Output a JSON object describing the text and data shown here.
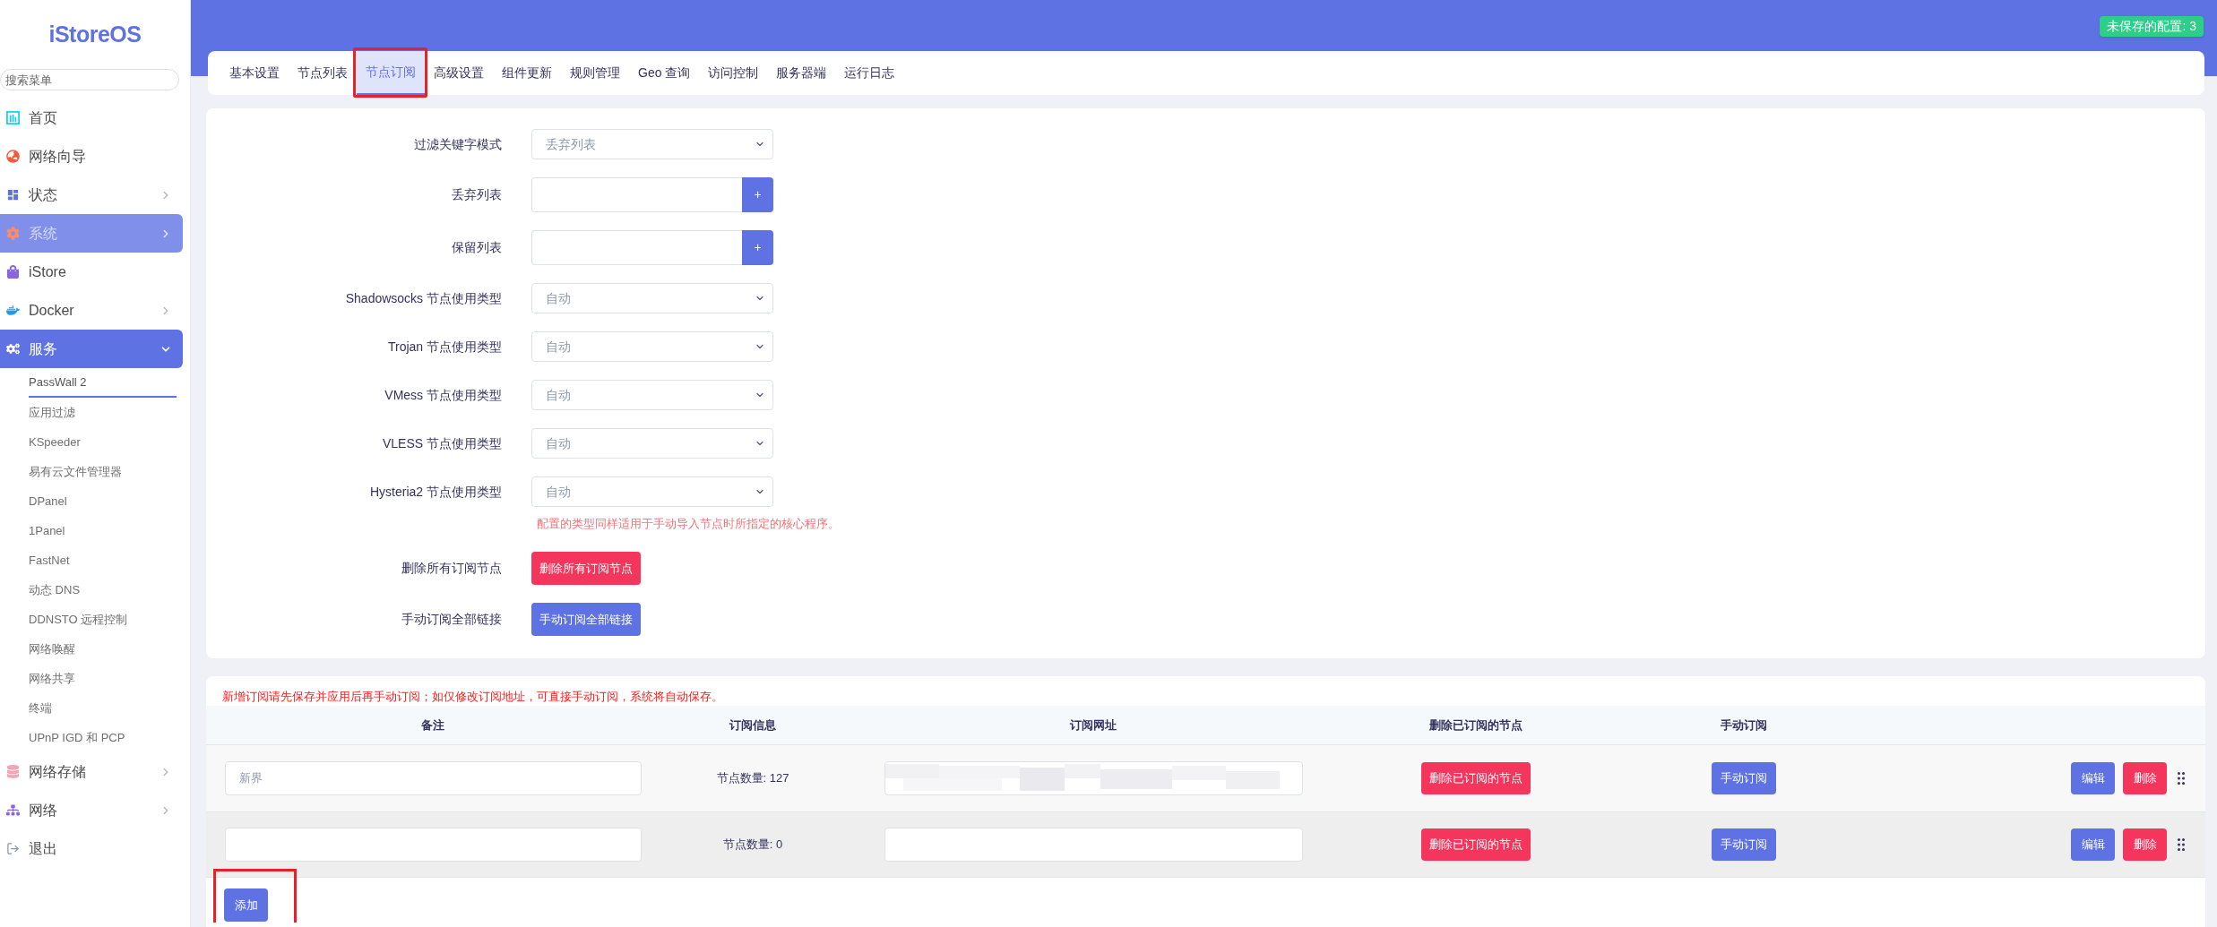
{
  "sidebar": {
    "logo": "iStoreOS",
    "search": {
      "placeholder": "搜索菜单"
    },
    "items": [
      {
        "label": "首页",
        "selected": false,
        "hovered": false
      },
      {
        "label": "网络向导",
        "selected": false,
        "hovered": false
      },
      {
        "label": "状态",
        "selected": false,
        "hovered": false,
        "expanded": false
      },
      {
        "label": "系统",
        "selected": false,
        "hovered": true,
        "expanded": false
      },
      {
        "label": "iStore",
        "selected": false,
        "hovered": false
      },
      {
        "label": "Docker",
        "selected": false,
        "hovered": false,
        "expanded": false
      },
      {
        "label": "服务",
        "selected": true,
        "hovered": false,
        "expanded": true,
        "children": [
          {
            "label": "PassWall 2",
            "selected": true
          },
          {
            "label": "应用过滤",
            "selected": false
          },
          {
            "label": "KSpeeder",
            "selected": false
          },
          {
            "label": "易有云文件管理器",
            "selected": false
          },
          {
            "label": "DPanel",
            "selected": false
          },
          {
            "label": "1Panel",
            "selected": false
          },
          {
            "label": "FastNet",
            "selected": false
          },
          {
            "label": "动态 DNS",
            "selected": false
          },
          {
            "label": "DDNSTO 远程控制",
            "selected": false
          },
          {
            "label": "网络唤醒",
            "selected": false
          },
          {
            "label": "网络共享",
            "selected": false
          },
          {
            "label": "终端",
            "selected": false
          },
          {
            "label": "UPnP IGD 和 PCP",
            "selected": false
          }
        ]
      },
      {
        "label": "网络存储",
        "selected": false,
        "hovered": false,
        "expanded": false
      },
      {
        "label": "网络",
        "selected": false,
        "hovered": false,
        "expanded": false
      },
      {
        "label": "退出",
        "selected": false,
        "hovered": false
      }
    ]
  },
  "header": {
    "unsaved_badge": "未保存的配置: 3"
  },
  "tabs": [
    {
      "label": "基本设置",
      "selected": false,
      "annotated": false
    },
    {
      "label": "节点列表",
      "selected": false,
      "annotated": false
    },
    {
      "label": "节点订阅",
      "selected": true,
      "annotated": true
    },
    {
      "label": "高级设置",
      "selected": false,
      "annotated": false
    },
    {
      "label": "组件更新",
      "selected": false,
      "annotated": false
    },
    {
      "label": "规则管理",
      "selected": false,
      "annotated": false
    },
    {
      "label": "Geo 查询",
      "selected": false,
      "annotated": false
    },
    {
      "label": "访问控制",
      "selected": false,
      "annotated": false
    },
    {
      "label": "服务器端",
      "selected": false,
      "annotated": false
    },
    {
      "label": "运行日志",
      "selected": false,
      "annotated": false
    }
  ],
  "filter_form": {
    "rows": [
      {
        "kind": "select",
        "label": "过滤关键字模式",
        "value": "丢弃列表"
      },
      {
        "kind": "list",
        "label": "丢弃列表",
        "button": "+"
      },
      {
        "kind": "list",
        "label": "保留列表",
        "button": "+"
      },
      {
        "kind": "select",
        "label": "Shadowsocks 节点使用类型",
        "value": "自动"
      },
      {
        "kind": "select",
        "label": "Trojan 节点使用类型",
        "value": "自动"
      },
      {
        "kind": "select",
        "label": "VMess 节点使用类型",
        "value": "自动"
      },
      {
        "kind": "select",
        "label": "VLESS 节点使用类型",
        "value": "自动"
      },
      {
        "kind": "select",
        "label": "Hysteria2 节点使用类型",
        "value": "自动",
        "hint": "配置的类型同样适用于手动导入节点时所指定的核心程序。"
      },
      {
        "kind": "button",
        "label": "删除所有订阅节点",
        "button": "删除所有订阅节点",
        "color": "#f5365c"
      },
      {
        "kind": "button",
        "label": "手动订阅全部链接",
        "button": "手动订阅全部链接",
        "color": "#5e72e4"
      }
    ]
  },
  "subscriptions": {
    "notice": "新增订阅请先保存并应用后再手动订阅；如仅修改订阅地址，可直接手动订阅，系统将自动保存。",
    "columns": [
      "备注",
      "订阅信息",
      "订阅网址",
      "删除已订阅的节点",
      "手动订阅"
    ],
    "rows": [
      {
        "remark": "新界",
        "info": "节点数量: 127",
        "url_redacted": true,
        "delete_nodes_button": "删除已订阅的节点",
        "subscribe_button": "手动订阅",
        "edit_button": "编辑",
        "remove_button": "删除"
      },
      {
        "info": "节点数量: 0",
        "url_redacted": false,
        "delete_nodes_button": "删除已订阅的节点",
        "subscribe_button": "手动订阅",
        "edit_button": "编辑",
        "remove_button": "删除"
      }
    ],
    "add_button": {
      "label": "添加",
      "annotated": true
    }
  }
}
